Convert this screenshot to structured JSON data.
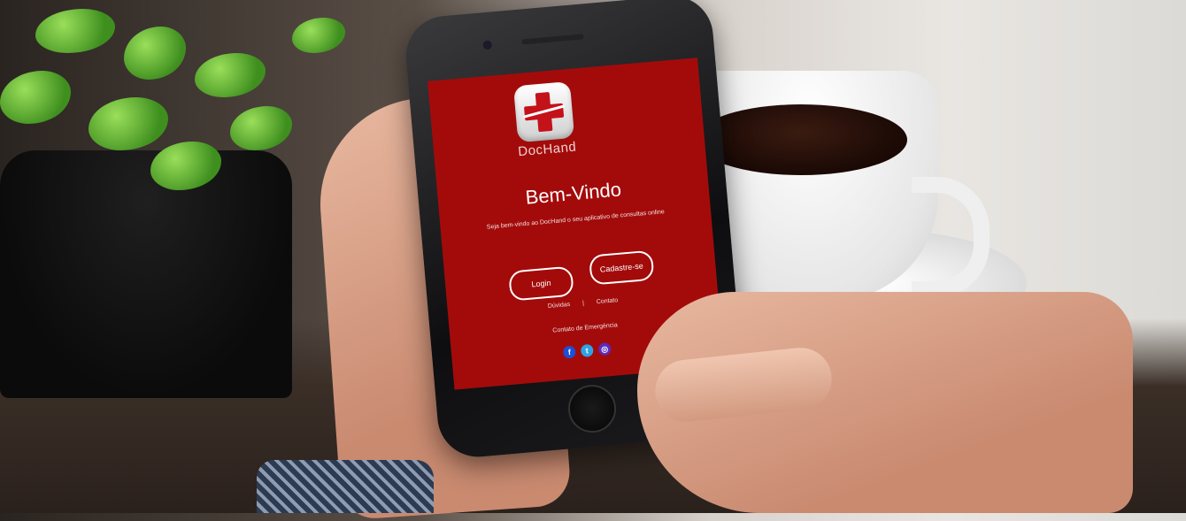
{
  "app": {
    "name": "DocHand",
    "welcome_title": "Bem-Vindo",
    "tagline": "Seja bem-vindo ao DocHand o seu aplicativo de consultas online"
  },
  "buttons": {
    "login": "Login",
    "signup": "Cadastre-se"
  },
  "links": {
    "faq": "Dúvidas",
    "separator": "|",
    "contact": "Contato",
    "emergency": "Contato de Emergência"
  },
  "social": [
    {
      "icon": "facebook-icon",
      "glyph": "f"
    },
    {
      "icon": "twitter-icon",
      "glyph": "t"
    },
    {
      "icon": "instagram-icon",
      "glyph": "◎"
    }
  ],
  "colors": {
    "screen_bg": "#a30b0b",
    "cross": "#c4121a"
  }
}
